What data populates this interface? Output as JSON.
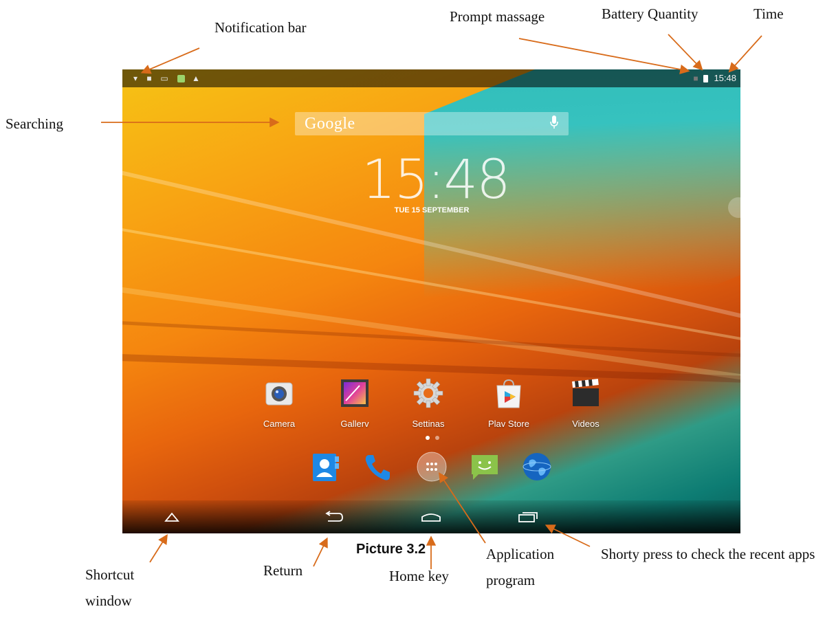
{
  "annotations": {
    "notification_bar": "Notification bar",
    "prompt_message": "Prompt massage",
    "battery_quantity": "Battery Quantity",
    "time": "Time",
    "searching": "Searching",
    "shortcut_window": "Shortcut window",
    "return": "Return",
    "caption": "Picture 3.2",
    "home_key": "Home key",
    "application_program": "Application program",
    "recent_apps": "Shorty press to check the recent apps"
  },
  "status_bar": {
    "time": "15:48",
    "left_icons": [
      "wifi-icon",
      "lock-icon",
      "screen-icon",
      "gallery-icon",
      "warning-icon"
    ],
    "right_icons": [
      "prompt-icon",
      "battery-icon"
    ]
  },
  "search": {
    "logo": "Google",
    "icon": "microphone-icon"
  },
  "clock": {
    "time": "15:48",
    "date": "TUE 15 SEPTEMBER"
  },
  "apps": [
    {
      "label": "Camera",
      "icon": "camera-icon"
    },
    {
      "label": "Gallerv",
      "icon": "gallery-icon"
    },
    {
      "label": "Settinas",
      "icon": "settings-gear-icon"
    },
    {
      "label": "Plav Store",
      "icon": "play-store-icon"
    },
    {
      "label": "Videos",
      "icon": "clapperboard-icon"
    }
  ],
  "page_indicator": {
    "current": 1,
    "total": 2
  },
  "dock": [
    "contacts-icon",
    "phone-icon",
    "app-drawer-icon",
    "messaging-icon",
    "browser-globe-icon"
  ],
  "nav": [
    "shortcut-window-icon",
    "back-icon",
    "home-icon",
    "recent-apps-icon"
  ],
  "colors": {
    "accent_arrow": "#d86b1a",
    "status_bar": "#1a1a1a",
    "teal": "#1aa79f",
    "orange": "#f29212"
  }
}
